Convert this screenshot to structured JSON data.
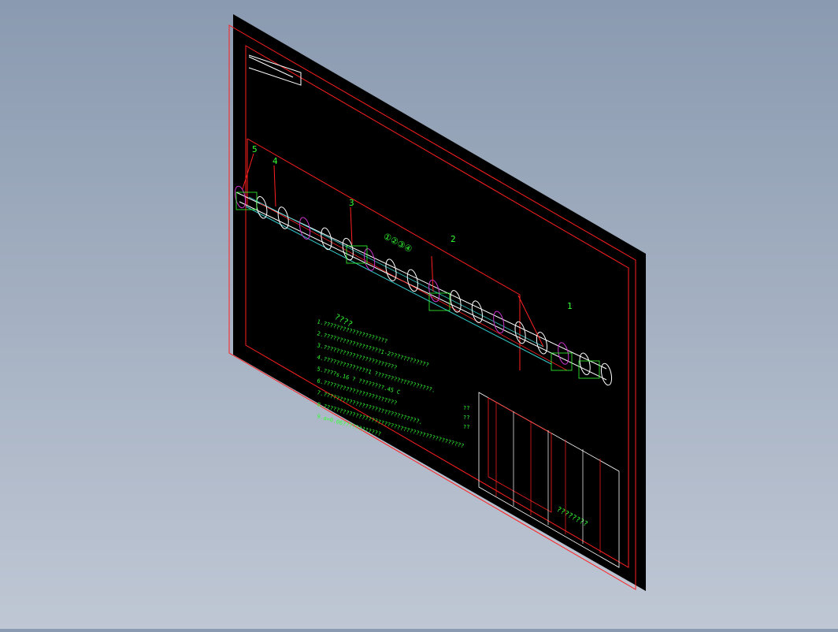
{
  "viewport": {
    "background_top": "#8a9ab0",
    "background_bottom": "#bfc7d4"
  },
  "drawing": {
    "sheet_color": "#000000",
    "border_color": "#ff2020",
    "line_color": "#ffffff",
    "text_color": "#33ff33",
    "accent_color": "#cc33cc",
    "secondary_line_color": "#33cccc",
    "part_labels": [
      "5",
      "4",
      "3",
      "2",
      "1"
    ],
    "section_marker": "①②③④",
    "notes_title": "????",
    "notes": [
      "1.????????????????????",
      "2.??????????????????1-2????????????",
      "3.???????????????????????",
      "4.??????????????1 ??????????????????.",
      "5.????s.16 ? ????????.45 C",
      "6.???????????????????????",
      "7.??????????????????????????????.",
      "8.????????????????????????????????????????????",
      "9.a=0.067???????????"
    ],
    "spec_labels": [
      "??",
      "??",
      "??"
    ],
    "title_block_text": "????????"
  }
}
